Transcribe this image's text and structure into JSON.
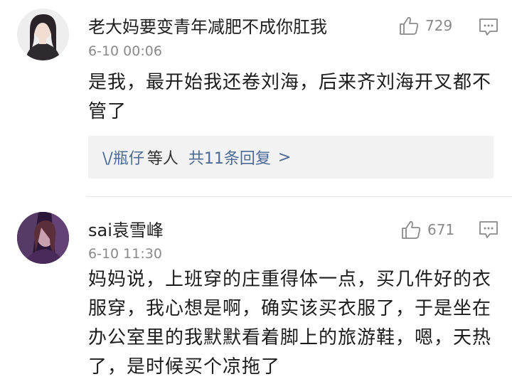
{
  "comments": [
    {
      "username": "老大妈要变青年减肥不成你肛我",
      "time": "6-10 00:06",
      "likes": "729",
      "text": "是我，最开始我还卷刘海，后来齐刘海开叉都不管了",
      "reply_preview": {
        "names": "\\/瓶仔",
        "rest": "等人",
        "count": "共11条回复",
        "arrow": ">"
      }
    },
    {
      "username": "sai袁雪峰",
      "time": "6-10 11:30",
      "likes": "671",
      "text": "妈妈说，上班穿的庄重得体一点，买几件好的衣服穿，我心想是啊，确实该买衣服了，于是坐在办公室里的我默默看着脚上的旅游鞋，嗯，天热了，是时候买个凉拖了"
    }
  ],
  "icons": {
    "like": "thumbs-up-icon",
    "reply": "comment-icon"
  },
  "colors": {
    "link": "#4b6a96",
    "meta": "#8a8a8a",
    "reply_bg": "#f2f2f2"
  }
}
